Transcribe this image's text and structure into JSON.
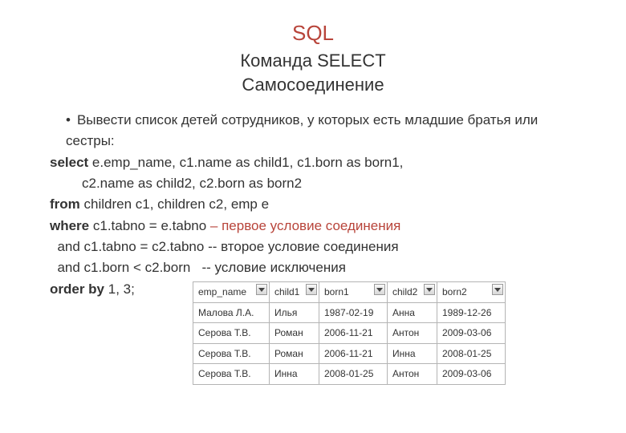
{
  "header": {
    "title": "SQL",
    "subtitle1": "Команда SELECT",
    "subtitle2": "Самосоединение"
  },
  "task": "Вывести список детей сотрудников, у которых есть младшие братья или сестры:",
  "sql": {
    "kw_select": "select",
    "select_cols": " e.emp_name, c1.name as child1, c1.born as born1,",
    "select_cols2": "c2.name as  child2, c2.born as born2",
    "kw_from": "from",
    "from_body": " children c1, children c2, emp e",
    "kw_where": "where",
    "where_body": " c1.tabno = e.tabno ",
    "cmt1": "– первое условие соединения",
    "and1": "  and c1.tabno = c2.tabno ",
    "cmt2": "-- второе условие соединения",
    "and2": "  and c1.born < c2.born   ",
    "cmt3": "-- условие исключения",
    "kw_order": "order by",
    "order_body": " 1, 3;"
  },
  "table": {
    "headers": [
      "emp_name",
      "child1",
      "born1",
      "child2",
      "born2"
    ],
    "rows": [
      [
        "Малова Л.А.",
        "Илья",
        "1987-02-19",
        "Анна",
        "1989-12-26"
      ],
      [
        "Серова Т.В.",
        "Роман",
        "2006-11-21",
        "Антон",
        "2009-03-06"
      ],
      [
        "Серова Т.В.",
        "Роман",
        "2006-11-21",
        "Инна",
        "2008-01-25"
      ],
      [
        "Серова Т.В.",
        "Инна",
        "2008-01-25",
        "Антон",
        "2009-03-06"
      ]
    ]
  }
}
